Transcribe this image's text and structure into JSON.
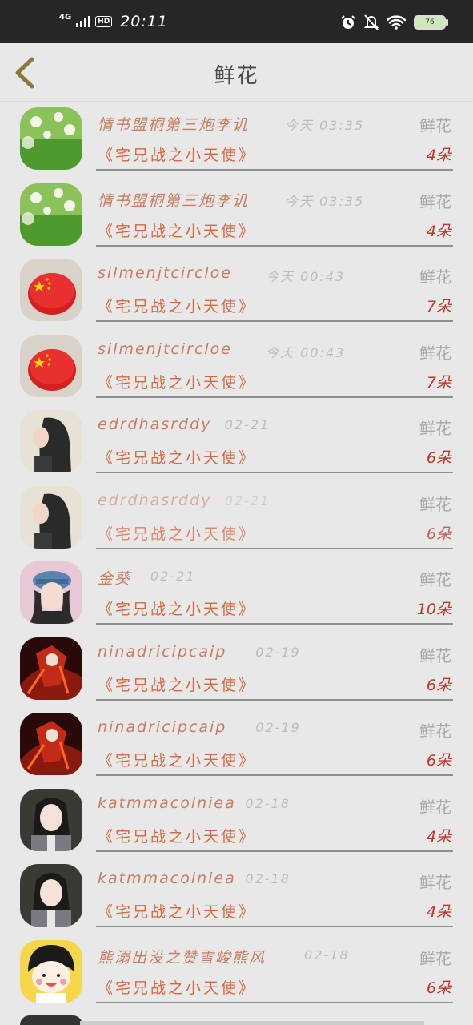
{
  "status_bar": {
    "network": "4G",
    "hd": "HD",
    "time": "20:11",
    "battery": "76"
  },
  "header": {
    "title": "鲜花"
  },
  "records": [
    {
      "name": "情书盟桐第三炮李讥",
      "time": "今天 03:35",
      "gift": "鲜花",
      "book": "《宅兄战之小天使》",
      "count": "4朵",
      "avatar": "green-flowers"
    },
    {
      "name": "情书盟桐第三炮李讥",
      "time": "今天 03:35",
      "gift": "鲜花",
      "book": "《宅兄战之小天使》",
      "count": "4朵",
      "avatar": "green-flowers"
    },
    {
      "name": "silmenjtcircloe",
      "time": "今天 00:43",
      "gift": "鲜花",
      "book": "《宅兄战之小天使》",
      "count": "7朵",
      "avatar": "red-flag-badge"
    },
    {
      "name": "silmenjtcircloe",
      "time": "今天 00:43",
      "gift": "鲜花",
      "book": "《宅兄战之小天使》",
      "count": "7朵",
      "avatar": "red-flag-badge"
    },
    {
      "name": "edrdhasrddy",
      "time": "02-21",
      "gift": "鲜花",
      "book": "《宅兄战之小天使》",
      "count": "6朵",
      "avatar": "girl-dark-hair"
    },
    {
      "name": "edrdhasrddy",
      "time": "02-21",
      "gift": "鲜花",
      "book": "《宅兄战之小天使》",
      "count": "6朵",
      "avatar": "girl-dark-hair"
    },
    {
      "name": "金葵",
      "time": "02-21",
      "gift": "鲜花",
      "book": "《宅兄战之小天使》",
      "count": "10朵",
      "avatar": "girl-blue-cap"
    },
    {
      "name": "ninadricipcaip",
      "time": "02-19",
      "gift": "鲜花",
      "book": "《宅兄战之小天使》",
      "count": "6朵",
      "avatar": "red-warrior"
    },
    {
      "name": "ninadricipcaip",
      "time": "02-19",
      "gift": "鲜花",
      "book": "《宅兄战之小天使》",
      "count": "6朵",
      "avatar": "red-warrior"
    },
    {
      "name": "katmmacolniea",
      "time": "02-18",
      "gift": "鲜花",
      "book": "《宅兄战之小天使》",
      "count": "4朵",
      "avatar": "girl-portrait"
    },
    {
      "name": "katmmacolniea",
      "time": "02-18",
      "gift": "鲜花",
      "book": "《宅兄战之小天使》",
      "count": "4朵",
      "avatar": "girl-portrait"
    },
    {
      "name": "熊溺出没之赞雪峻熊风",
      "time": "02-18",
      "gift": "鲜花",
      "book": "《宅兄战之小天使》",
      "count": "6朵",
      "avatar": "cartoon-girl"
    }
  ]
}
